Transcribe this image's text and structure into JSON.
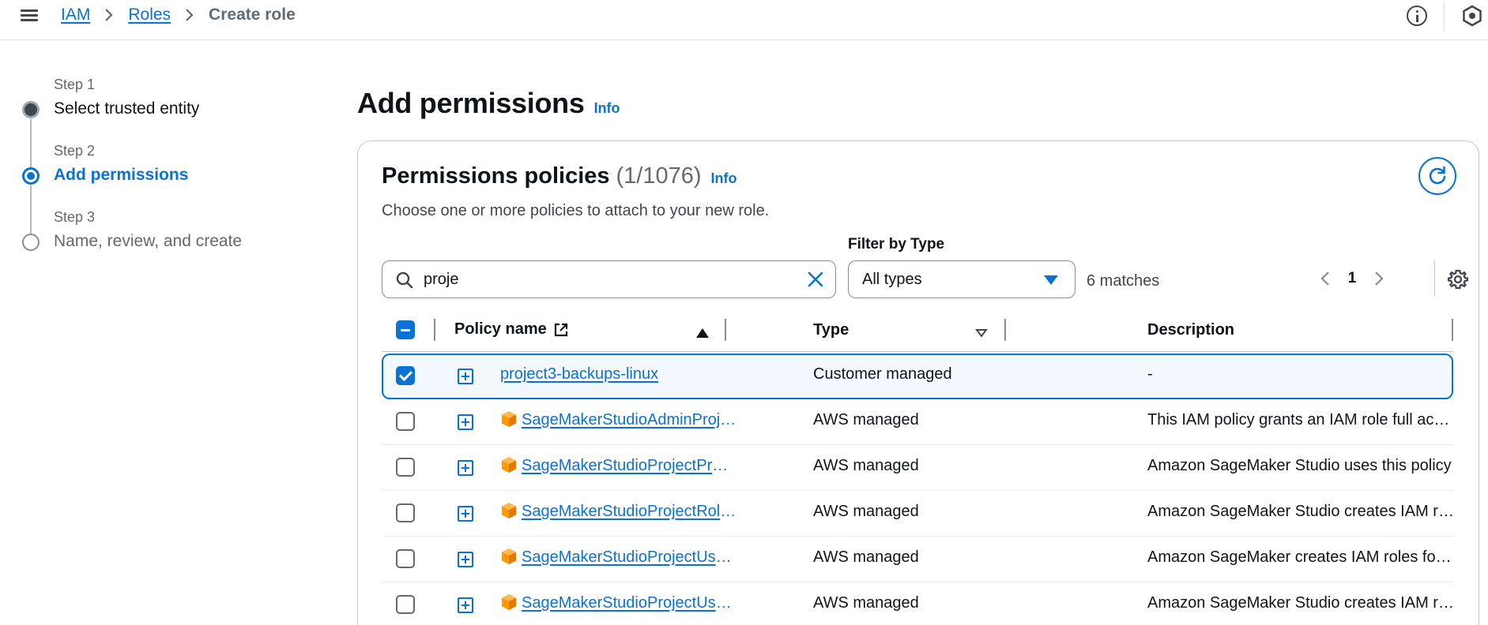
{
  "breadcrumb": {
    "items": [
      "IAM",
      "Roles"
    ],
    "current": "Create role"
  },
  "steps": [
    {
      "number": "Step 1",
      "label": "Select trusted entity",
      "state": "done"
    },
    {
      "number": "Step 2",
      "label": "Add permissions",
      "state": "current"
    },
    {
      "number": "Step 3",
      "label": "Name, review, and create",
      "state": "todo"
    }
  ],
  "page": {
    "title": "Add permissions",
    "info": "Info"
  },
  "policies": {
    "title": "Permissions policies",
    "count": "(1/1076)",
    "info": "Info",
    "description": "Choose one or more policies to attach to your new role.",
    "filter_label": "Filter by Type",
    "search_value": "proje",
    "type_selected": "All types",
    "matches": "6 matches",
    "page": "1",
    "columns": {
      "name": "Policy name",
      "type": "Type",
      "description": "Description"
    },
    "rows": [
      {
        "name": "project3-backups-linux",
        "type": "Customer managed",
        "description": "-",
        "checked": true,
        "aws": false
      },
      {
        "name": "SageMakerStudioAdminProjectUserRolePolicy",
        "type": "AWS managed",
        "description": "This IAM policy grants an IAM role full access",
        "checked": false,
        "aws": true
      },
      {
        "name": "SageMakerStudioProjectProvisioningRolePolicy",
        "type": "AWS managed",
        "description": "Amazon SageMaker Studio uses this policy",
        "checked": false,
        "aws": true
      },
      {
        "name": "SageMakerStudioProjectRoleMachineLearningPolicy",
        "type": "AWS managed",
        "description": "Amazon SageMaker Studio creates IAM roles",
        "checked": false,
        "aws": true
      },
      {
        "name": "SageMakerStudioProjectUserRolePermissionsBoundary",
        "type": "AWS managed",
        "description": "Amazon SageMaker creates IAM roles for users",
        "checked": false,
        "aws": true
      },
      {
        "name": "SageMakerStudioProjectUserRolePolicy",
        "type": "AWS managed",
        "description": "Amazon SageMaker Studio creates IAM roles",
        "checked": false,
        "aws": true
      }
    ]
  },
  "icons": {
    "menu": "hamburger-icon",
    "info": "info-icon",
    "profile": "hexagon-icon",
    "search": "search-icon",
    "clear": "close-icon",
    "refresh": "refresh-icon",
    "settings": "gear-icon",
    "external": "external-link-icon",
    "aws": "aws-cube-icon"
  },
  "colors": {
    "link": "#0972d3",
    "text": "#0f141a",
    "aws_orange": "#ff9900"
  }
}
